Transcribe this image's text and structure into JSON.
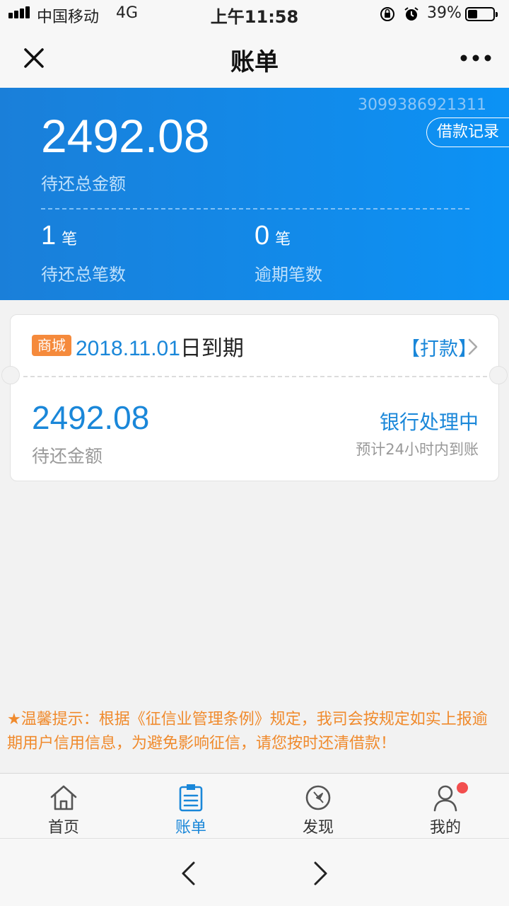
{
  "status_bar": {
    "carrier": "中国移动",
    "network": "4G",
    "time": "上午11:58",
    "battery_percent": "39%",
    "battery_level": 0.39,
    "icons": [
      "signal-icon",
      "orientation-lock-icon",
      "alarm-icon",
      "battery-icon"
    ]
  },
  "nav": {
    "title": "账单",
    "icons": [
      "close-icon",
      "more-icon"
    ]
  },
  "summary": {
    "account_no": "3099386921311",
    "record_button": "借款记录",
    "total_amount": "2492.08",
    "total_amount_label": "待还总金额",
    "pending_count": "1",
    "pending_unit": "笔",
    "pending_label": "待还总笔数",
    "overdue_count": "0",
    "overdue_unit": "笔",
    "overdue_label": "逾期笔数"
  },
  "bill": {
    "tag": "商城",
    "due_date": "2018.11.01",
    "due_suffix": "日到期",
    "action": "【打款】",
    "amount": "2492.08",
    "amount_label": "待还金额",
    "status": "银行处理中",
    "eta": "预计24小时内到账"
  },
  "tip": {
    "star": "★",
    "text": "温馨提示：根据《征信业管理条例》规定，我司会按规定如实上报逾期用户信用信息，为避免影响征信，请您按时还清借款！"
  },
  "tabs": [
    {
      "label": "首页",
      "icon": "home-icon"
    },
    {
      "label": "账单",
      "icon": "bill-icon"
    },
    {
      "label": "发现",
      "icon": "compass-icon"
    },
    {
      "label": "我的",
      "icon": "user-icon"
    }
  ],
  "active_tab": "账单",
  "colors": {
    "accent": "#1a87d9",
    "header_gradient_start": "#1a7fd9",
    "header_gradient_end": "#0c92f5",
    "tag": "#f58a3c",
    "tip": "#f08a2c",
    "badge": "#f24e4e"
  },
  "browser": {
    "icons": [
      "back-arrow-icon",
      "forward-arrow-icon"
    ]
  }
}
